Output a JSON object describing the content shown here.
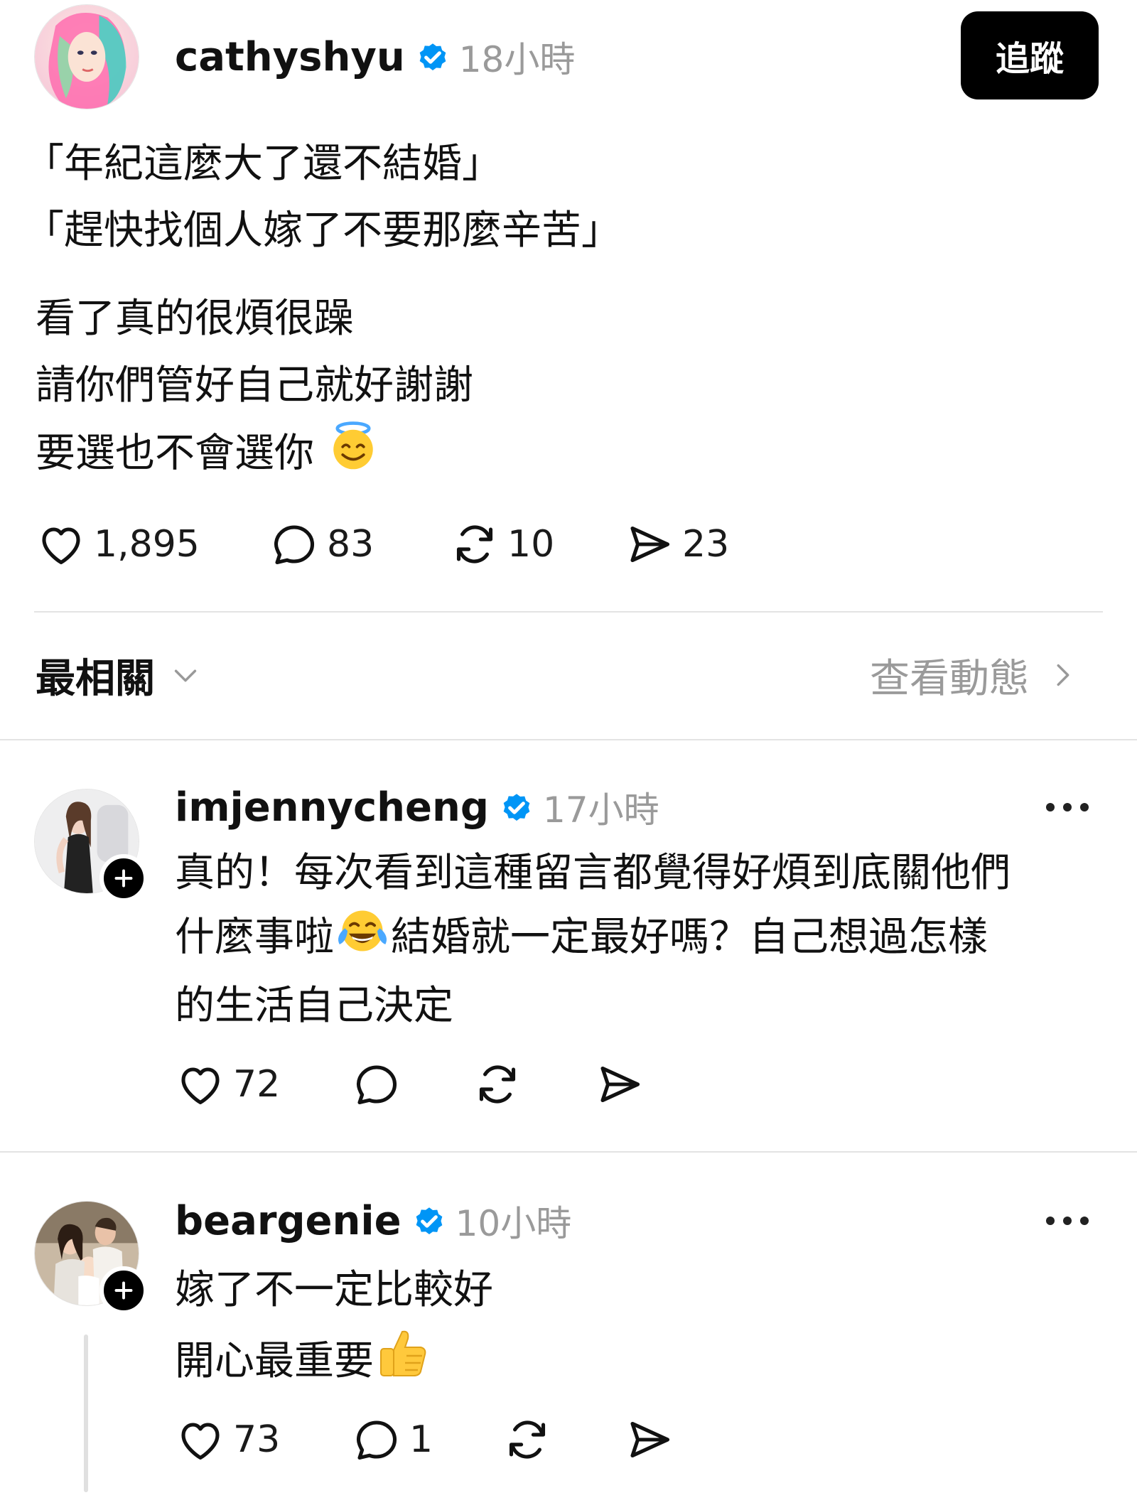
{
  "post": {
    "username": "cathyshyu",
    "time": "18小時",
    "follow_label": "追蹤",
    "lines_group1": [
      "「年紀這麼大了還不結婚」",
      "「趕快找個人嫁了不要那麼辛苦」"
    ],
    "lines_group2": [
      "看了真的很煩很躁",
      "請你們管好自己就好謝謝",
      "要選也不會選你"
    ],
    "emoji": "smiling-face-with-halo",
    "likes": "1,895",
    "comments": "83",
    "reposts": "10",
    "shares": "23"
  },
  "sort_bar": {
    "label": "最相關",
    "activity_link": "查看動態"
  },
  "replies": [
    {
      "username": "imjennycheng",
      "time": "17小時",
      "lines": [
        "真的！每次看到這種留言都覺得好煩到底關他們",
        "什麼事啦",
        "結婚就一定最好嗎？自己想過怎樣",
        "的生活自己決定"
      ],
      "emoji": "face-with-tears-of-joy",
      "likes": "72"
    },
    {
      "username": "beargenie",
      "time": "10小時",
      "lines": [
        "嫁了不一定比較好",
        "開心最重要"
      ],
      "emoji": "thumbs-up",
      "likes": "73",
      "comments": "1"
    }
  ],
  "colors": {
    "verified": "#0095f6",
    "muted": "#9a9a9a",
    "divider": "#e3e3e3"
  }
}
